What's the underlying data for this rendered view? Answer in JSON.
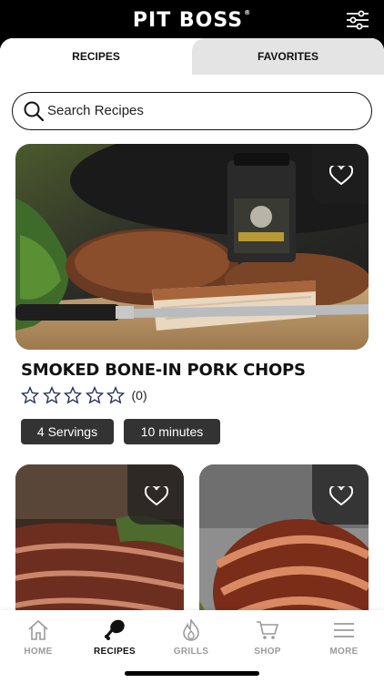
{
  "header": {
    "logo_text": "PIT BOSS",
    "logo_mark": "®",
    "filter_icon": "sliders-icon"
  },
  "tabs": [
    {
      "label": "RECIPES",
      "active": true
    },
    {
      "label": "FAVORITES",
      "active": false
    }
  ],
  "search": {
    "placeholder": "Search Recipes",
    "value": "",
    "icon": "search-icon"
  },
  "featured": {
    "title": "SMOKED BONE-IN PORK CHOPS",
    "rating_stars": 0,
    "rating_max": 5,
    "rating_count": "(0)",
    "servings": "4 Servings",
    "time": "10 minutes",
    "favorite_icon": "heart-outline-icon"
  },
  "nav": [
    {
      "label": "HOME",
      "icon": "home-icon",
      "active": false
    },
    {
      "label": "RECIPES",
      "icon": "drumstick-icon",
      "active": true
    },
    {
      "label": "GRILLS",
      "icon": "flame-icon",
      "active": false
    },
    {
      "label": "SHOP",
      "icon": "cart-icon",
      "active": false
    },
    {
      "label": "MORE",
      "icon": "menu-icon",
      "active": false
    }
  ],
  "colors": {
    "accent": "#111111",
    "tag_bg": "#333333",
    "nav_inactive": "#9a9a9a",
    "tab_inactive_bg": "#e4e4e4"
  }
}
